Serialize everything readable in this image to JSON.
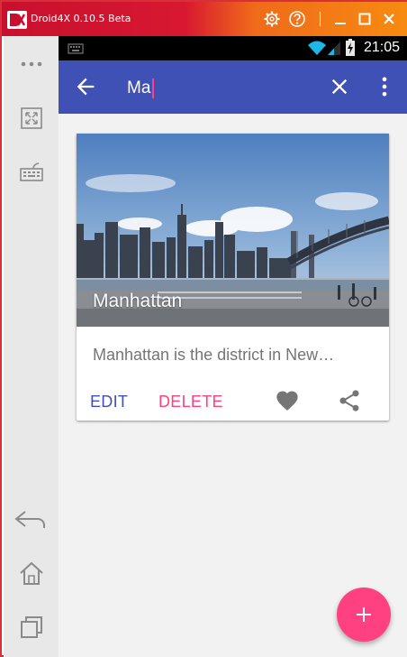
{
  "window": {
    "title": "Droid4X 0.10.5 Beta",
    "controls": [
      "settings-icon",
      "help-icon",
      "minimize-icon",
      "maximize-icon",
      "close-icon"
    ]
  },
  "sidebar": {
    "items": [
      "more-icon",
      "fullscreen-icon",
      "keyboard-icon",
      "back-icon",
      "home-icon",
      "recent-apps-icon"
    ]
  },
  "statusbar": {
    "time": "21:05",
    "icons": [
      "keyboard-notification-icon",
      "wifi-icon",
      "signal-icon",
      "battery-icon"
    ]
  },
  "appbar": {
    "search_value": "Ma",
    "back_icon": "arrow-back-icon",
    "clear_icon": "close-icon",
    "menu_icon": "more-vert-icon"
  },
  "card": {
    "title": "Manhattan",
    "description": "Manhattan is the district in New…",
    "edit_label": "EDIT",
    "delete_label": "DELETE",
    "icons": [
      "favorite-icon",
      "share-icon"
    ]
  },
  "fab": {
    "icon": "add-icon"
  },
  "colors": {
    "primary": "#3f51b5",
    "accent": "#ff4081",
    "title_gradient_start": "#c8102e",
    "title_gradient_end": "#f78b10"
  }
}
